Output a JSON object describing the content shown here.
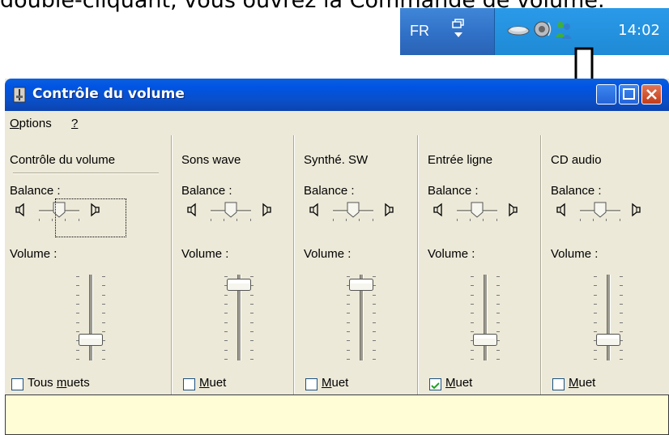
{
  "background_text": "double-cliquant, vous ouvrez la Commande de volume.",
  "taskbar": {
    "language": "FR",
    "clock": "14:02",
    "icons": [
      "keyboard-layout-icon",
      "network-icon",
      "volume-icon",
      "messenger-icon"
    ]
  },
  "window": {
    "title": "Contrôle du volume",
    "menu": [
      {
        "label": "Options",
        "accel": "O"
      },
      {
        "label": "?",
        "accel": "?"
      }
    ],
    "balance_label": "Balance :",
    "volume_label": "Volume :",
    "columns": [
      {
        "title": "Contrôle du volume",
        "mute_label": "Tous muets",
        "mute_prefix": "Tous ",
        "mute_accel": "m",
        "mute_rest": "uets",
        "muted": false,
        "balance": 0.5,
        "volume": 0.2,
        "focused": true
      },
      {
        "title": "Sons wave",
        "mute_label": "Muet",
        "mute_prefix": "",
        "mute_accel": "M",
        "mute_rest": "uet",
        "muted": false,
        "balance": 0.5,
        "volume": 0.95,
        "focused": false
      },
      {
        "title": "Synthé. SW",
        "mute_label": "Muet",
        "mute_prefix": "",
        "mute_accel": "M",
        "mute_rest": "uet",
        "muted": false,
        "balance": 0.5,
        "volume": 0.95,
        "focused": false
      },
      {
        "title": "Entrée ligne",
        "mute_label": "Muet",
        "mute_prefix": "",
        "mute_accel": "M",
        "mute_rest": "uet",
        "muted": true,
        "balance": 0.5,
        "volume": 0.2,
        "focused": false
      },
      {
        "title": "CD audio",
        "mute_label": "Muet",
        "mute_prefix": "",
        "mute_accel": "M",
        "mute_rest": "uet",
        "muted": false,
        "balance": 0.5,
        "volume": 0.2,
        "focused": false
      }
    ]
  },
  "colors": {
    "titlebar": "#0054e3",
    "window_bg": "#ece9d8",
    "status_bg": "#fffdd6",
    "taskbar": "#2f6fc5"
  }
}
